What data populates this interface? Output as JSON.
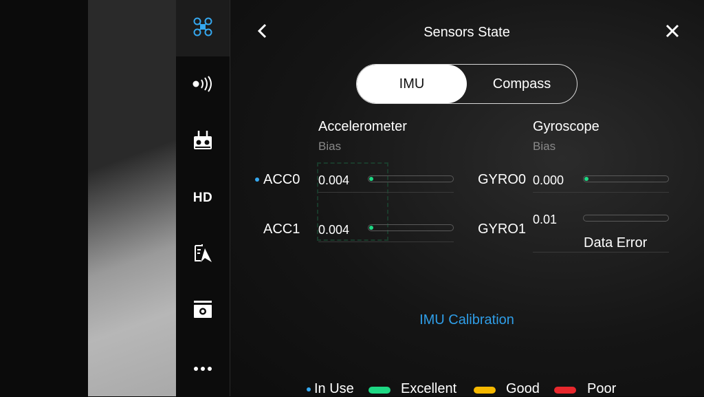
{
  "header": {
    "title": "Sensors State"
  },
  "sidebar": {
    "items": [
      {
        "icon": "drone-icon",
        "active": true
      },
      {
        "icon": "signal-icon"
      },
      {
        "icon": "remote-controller-icon"
      },
      {
        "icon": "hd-icon",
        "label": "HD"
      },
      {
        "icon": "map-navigation-icon"
      },
      {
        "icon": "camera-icon"
      },
      {
        "icon": "more-icon"
      }
    ]
  },
  "tabs": [
    {
      "label": "IMU",
      "active": true
    },
    {
      "label": "Compass",
      "active": false
    }
  ],
  "accelerometer": {
    "heading": "Accelerometer",
    "sub": "Bias",
    "rows": [
      {
        "label": "ACC0",
        "value": "0.004",
        "fill": 0.03,
        "in_use": true
      },
      {
        "label": "ACC1",
        "value": "0.004",
        "fill": 0.03,
        "in_use": false
      }
    ]
  },
  "gyroscope": {
    "heading": "Gyroscope",
    "sub": "Bias",
    "rows": [
      {
        "label": "GYRO0",
        "value": "0.000",
        "fill": 0.03
      },
      {
        "label": "GYRO1",
        "value": "0.01",
        "fill": 0,
        "status": "Data Error"
      }
    ]
  },
  "calibration": {
    "label": "IMU Calibration"
  },
  "legend": {
    "in_use": "In Use",
    "excellent": "Excellent",
    "good": "Good",
    "poor": "Poor"
  },
  "colors": {
    "accent_blue": "#2f9ee8",
    "dot_blue": "#35a8f0",
    "excellent": "#1ed884",
    "good": "#f5b800",
    "poor": "#e8282d"
  }
}
